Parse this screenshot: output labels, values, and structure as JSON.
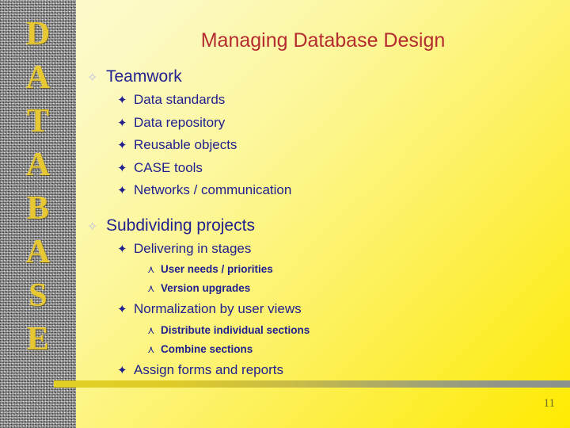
{
  "slide": {
    "title": "Managing Database Design",
    "page_number": "11",
    "colors": {
      "title": "#b42b30",
      "body_text": "#1f1f8f",
      "sidebar_letter": "#e8c832",
      "background_top_left": "#fdfbcf",
      "background_bottom_right": "#ffeb00",
      "footer_bar_left": "#e3cf24",
      "footer_bar_right": "#8a918e",
      "page_number": "#6f6b2a"
    }
  },
  "sidebar": {
    "word": "DATABASE",
    "letters": [
      "D",
      "A",
      "T",
      "A",
      "B",
      "A",
      "S",
      "E"
    ]
  },
  "bullets": {
    "glyph_level1": "✧",
    "glyph_level2": "✦",
    "glyph_level3": "⋏",
    "icon_name_level1": "hollow-star-bullet-icon",
    "icon_name_level2": "filled-star-bullet-icon",
    "icon_name_level3": "up-arrow-bullet-icon"
  },
  "outline": [
    {
      "level": 1,
      "text": "Teamwork",
      "gap_before": false
    },
    {
      "level": 2,
      "text": "Data standards",
      "gap_before": false
    },
    {
      "level": 2,
      "text": "Data repository",
      "gap_before": false
    },
    {
      "level": 2,
      "text": "Reusable objects",
      "gap_before": false
    },
    {
      "level": 2,
      "text": "CASE tools",
      "gap_before": false
    },
    {
      "level": 2,
      "text": "Networks / communication",
      "gap_before": false
    },
    {
      "level": 1,
      "text": "Subdividing projects",
      "gap_before": true
    },
    {
      "level": 2,
      "text": "Delivering in stages",
      "gap_before": false
    },
    {
      "level": 3,
      "text": "User needs / priorities",
      "gap_before": false
    },
    {
      "level": 3,
      "text": "Version upgrades",
      "gap_before": false
    },
    {
      "level": 2,
      "text": "Normalization by user views",
      "gap_before": false
    },
    {
      "level": 3,
      "text": "Distribute individual sections",
      "gap_before": false
    },
    {
      "level": 3,
      "text": "Combine sections",
      "gap_before": false
    },
    {
      "level": 2,
      "text": "Assign forms and reports",
      "gap_before": false
    }
  ]
}
